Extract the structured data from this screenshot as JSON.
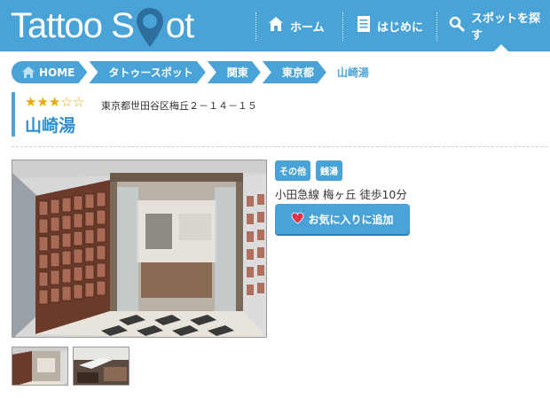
{
  "header": {
    "logo_left": "Tattoo S",
    "logo_right": "ot",
    "nav": [
      {
        "label": "ホーム",
        "icon": "house-icon"
      },
      {
        "label": "はじめに",
        "icon": "document-icon"
      },
      {
        "label": "スポットを探す",
        "icon": "search-icon"
      }
    ]
  },
  "breadcrumb": [
    "HOME",
    "タトゥースポット",
    "関東",
    "東京都",
    "山崎湯"
  ],
  "spot": {
    "rating": 3,
    "rating_max": 5,
    "address": "東京都世田谷区梅丘２－１４－１５",
    "name": "山崎湯",
    "tags": [
      "その他",
      "銭湯"
    ],
    "access": "小田急線 梅ヶ丘 徒歩10分",
    "favorite_label": "お気に入りに追加"
  },
  "colors": {
    "brand": "#4aa3d6",
    "title": "#2f8fcc",
    "star": "#e8a800",
    "heart": "#e0334a"
  }
}
